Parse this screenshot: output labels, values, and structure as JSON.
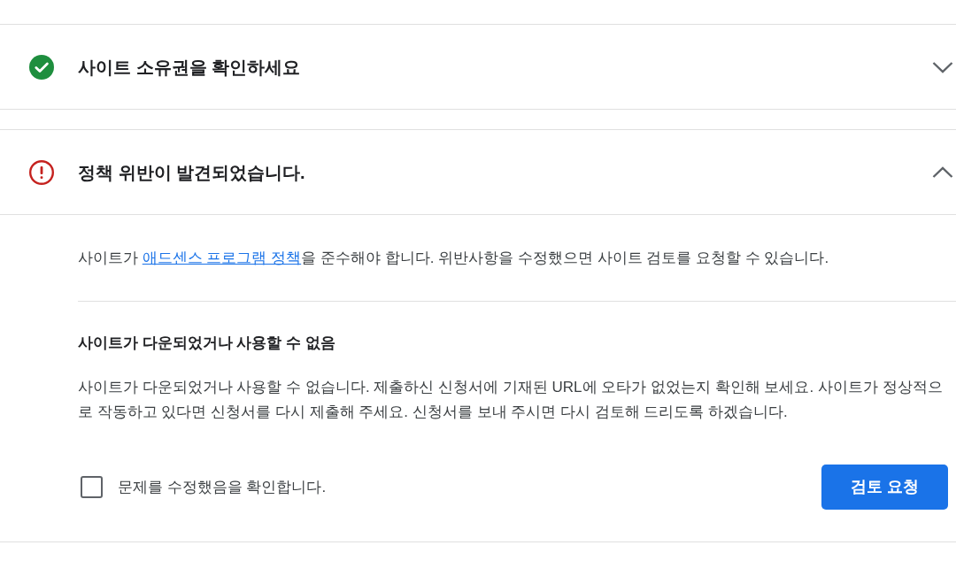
{
  "panels": [
    {
      "kind": "success",
      "title": "사이트 소유권을 확인하세요",
      "expanded": false
    },
    {
      "kind": "error",
      "title": "정책 위반이 발견되었습니다.",
      "expanded": true,
      "intro": {
        "before": "사이트가 ",
        "link": "애드센스 프로그램 정책",
        "after": "을 준수해야 합니다. 위반사항을 수정했으면 사이트 검토를 요청할 수 있습니다."
      },
      "issues": [
        {
          "title": "사이트가 다운되었거나 사용할 수 없음",
          "description": "사이트가 다운되었거나 사용할 수 없습니다. 제출하신 신청서에 기재된 URL에 오타가 없었는지 확인해 보세요. 사이트가 정상적으로 작동하고 있다면 신청서를 다시 제출해 주세요. 신청서를 보내 주시면 다시 검토해 드리도록 하겠습니다."
        }
      ],
      "confirm": {
        "label": "문제를 수정했음을 확인합니다.",
        "checked": false
      },
      "button": "검토 요청"
    }
  ]
}
